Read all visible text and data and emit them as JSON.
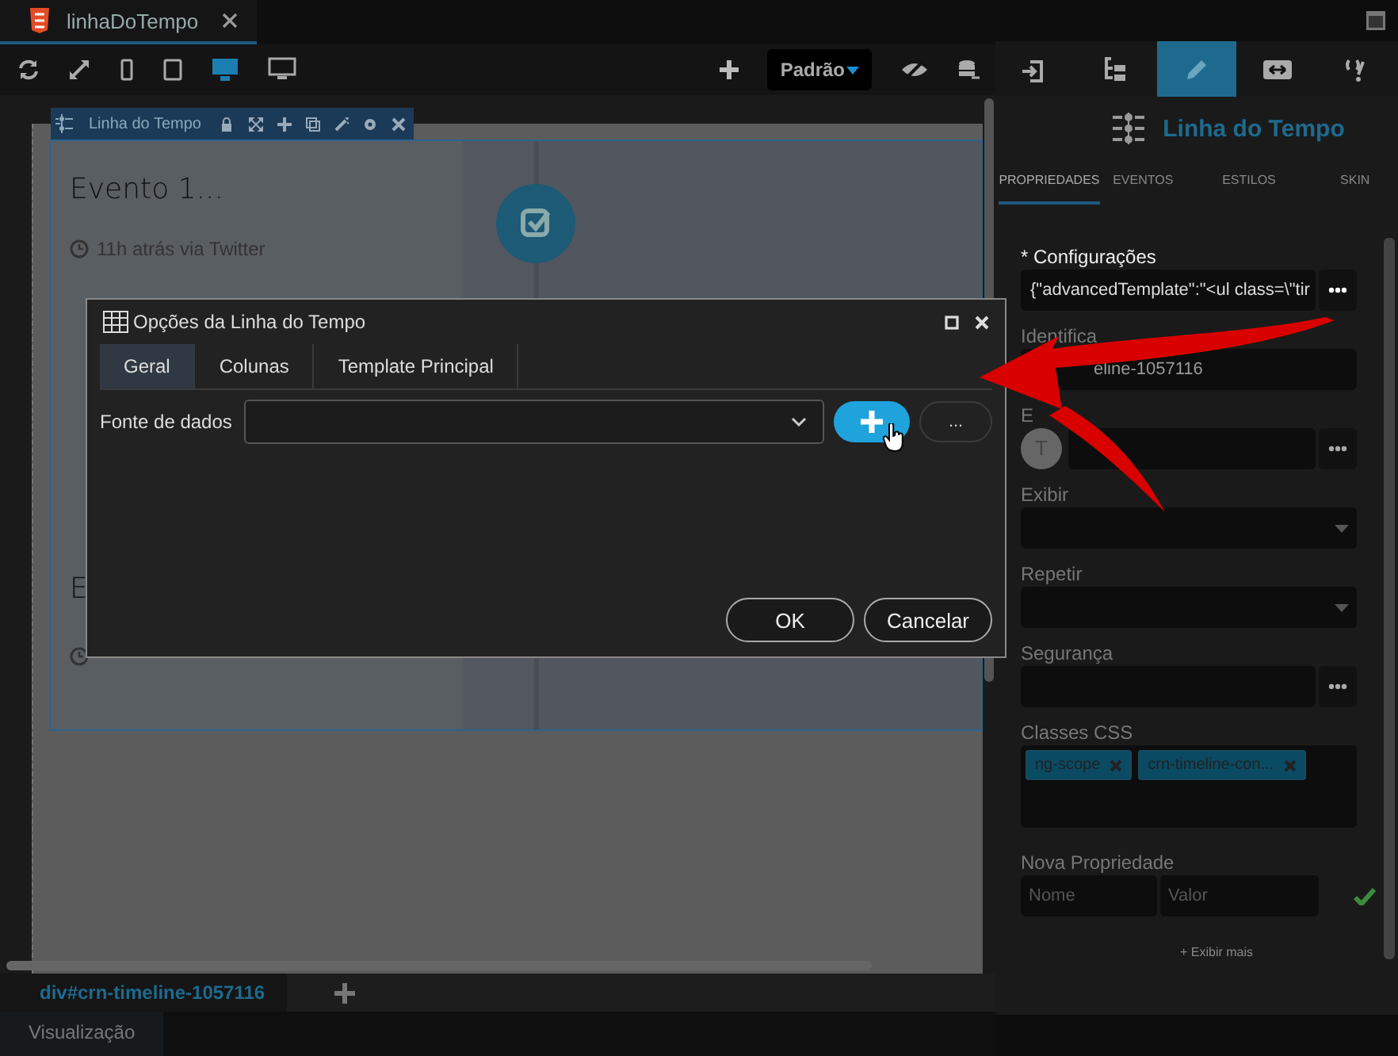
{
  "editor_tab": {
    "title": "linhaDoTempo"
  },
  "toolbar": {
    "devices": [
      {
        "kind": "phone",
        "selected": false
      },
      {
        "kind": "tablet",
        "selected": false
      },
      {
        "kind": "desktop",
        "selected": true
      },
      {
        "kind": "monitor",
        "selected": false
      }
    ],
    "theme": "Padrão"
  },
  "component_bar": {
    "title": "Linha do Tempo"
  },
  "timeline": {
    "events": [
      {
        "title": "Evento 1...",
        "meta": "11h atrás via Twitter"
      },
      {
        "title": "E"
      }
    ]
  },
  "dialog": {
    "title": "Opções da Linha do Tempo",
    "tabs": [
      {
        "label": "Geral",
        "selected": true
      },
      {
        "label": "Colunas",
        "selected": false
      },
      {
        "label": "Template Principal",
        "selected": false
      }
    ],
    "field_label": "Fonte de dados",
    "more_button": "...",
    "buttons": [
      "OK",
      "Cancelar"
    ]
  },
  "breadcrumb": "div#crn-timeline-1057116",
  "bottom_tab": "Visualização",
  "panel": {
    "tool_tabs": [
      {
        "kind": "import",
        "selected": false
      },
      {
        "kind": "tree",
        "selected": false
      },
      {
        "kind": "edit",
        "selected": true
      },
      {
        "kind": "resize",
        "selected": false
      },
      {
        "kind": "code",
        "selected": false
      }
    ],
    "component_title": "Linha do Tempo",
    "tabs": [
      {
        "label": "PROPRIEDADES",
        "selected": true
      },
      {
        "label": "EVENTOS",
        "selected": false
      },
      {
        "label": "ESTILOS",
        "selected": false
      },
      {
        "label": "SKIN",
        "selected": false
      }
    ],
    "fields": [
      {
        "kind": "text-more",
        "label": "* Configurações",
        "value": "{\"advancedTemplate\":\"<ul class=\\\"tir"
      },
      {
        "kind": "text",
        "label": "Identifica",
        "value": "eline-1057116"
      },
      {
        "kind": "avatar-more",
        "label": "E",
        "avatar": "T"
      },
      {
        "kind": "select",
        "label": "Exibir"
      },
      {
        "kind": "select",
        "label": "Repetir"
      },
      {
        "kind": "text-more",
        "label": "Segurança"
      },
      {
        "kind": "tags",
        "label": "Classes CSS",
        "tags": [
          "ng-scope",
          "crn-timeline-con..."
        ]
      },
      {
        "kind": "pair",
        "label": "Nova Propriedade",
        "placeholders": [
          "Nome",
          "Valor"
        ]
      }
    ],
    "show_more": "+ Exibir mais"
  }
}
